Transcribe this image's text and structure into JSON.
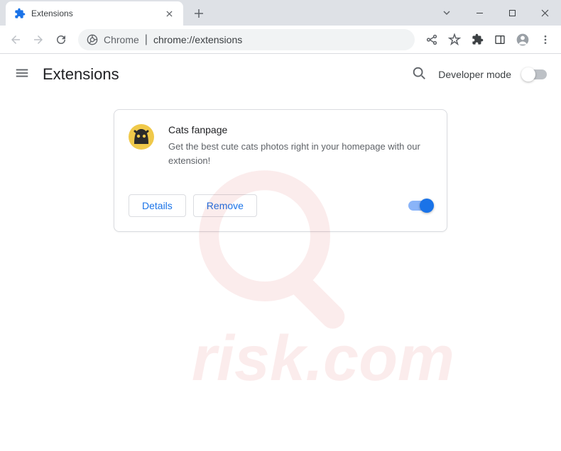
{
  "browser": {
    "tab_title": "Extensions",
    "omnibox_label": "Chrome",
    "omnibox_url": "chrome://extensions"
  },
  "header": {
    "title": "Extensions",
    "dev_mode_label": "Developer mode"
  },
  "extension": {
    "name": "Cats fanpage",
    "description": "Get the best cute cats photos right in your homepage with our extension!",
    "details_label": "Details",
    "remove_label": "Remove",
    "enabled": true
  },
  "watermark_text": "risk.com"
}
